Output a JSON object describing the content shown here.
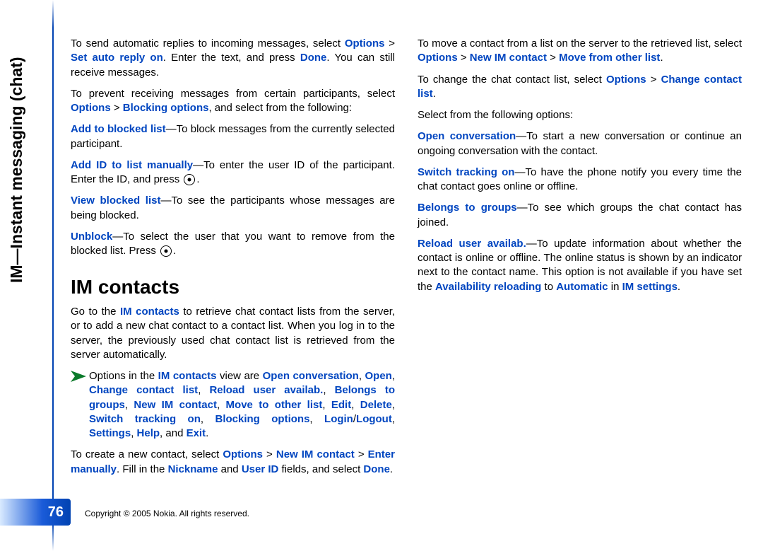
{
  "side_title": "IM—Instant messaging (chat)",
  "page_number": "76",
  "footer": "Copyright © 2005 Nokia. All rights reserved.",
  "heading": "IM contacts",
  "left": {
    "auto_reply_1": "To send automatic replies to incoming messages, select ",
    "auto_reply_2": "Options",
    "auto_reply_3": " > ",
    "auto_reply_4": "Set auto reply on",
    "auto_reply_5": ". Enter the text, and press ",
    "auto_reply_6": "Done",
    "auto_reply_7": ". You can still receive messages.",
    "block_prev_1": "To prevent receiving messages from certain participants, select ",
    "block_prev_2": "Options",
    "block_prev_3": " > ",
    "block_prev_4": "Blocking options",
    "block_prev_5": ", and select from the following:",
    "add_block_1": "Add to blocked list",
    "add_block_2": "—To block messages from the currently selected participant.",
    "add_id_1": "Add ID to list manually",
    "add_id_2": "—To enter the user ID of the participant. Enter the ID, and press ",
    "add_id_3": ".",
    "view_block_1": "View blocked list",
    "view_block_2": "—To see the participants whose messages are being blocked.",
    "unblock_1": "Unblock",
    "unblock_2": "—To select the user that you want to remove from the blocked list. Press ",
    "unblock_3": ".",
    "goto_1": "Go to the ",
    "goto_2": "IM contacts",
    "goto_3": " to retrieve chat contact lists from the server, or to add a new chat contact to a contact list. When you log in to the server, the previously used chat contact list is retrieved from the server automatically.",
    "optlist_1": "Options in the ",
    "optlist_2": "IM contacts",
    "optlist_3": " view are ",
    "optlist_4": "Open conversation",
    "optlist_5": ", ",
    "optlist_6": "Open",
    "optlist_7": ", ",
    "optlist_8": "Change contact list",
    "optlist_9": ", ",
    "optlist_10": "Reload user availab.",
    "optlist_11": ", ",
    "optlist_12": "Belongs to groups",
    "optlist_13": ", ",
    "optlist_14": "New IM contact",
    "optlist_15": ", ",
    "optlist_16": "Move to"
  },
  "right": {
    "optlist2_1": "other list",
    "optlist2_2": ", ",
    "optlist2_3": "Edit",
    "optlist2_4": ", ",
    "optlist2_5": "Delete",
    "optlist2_6": ", ",
    "optlist2_7": "Switch tracking on",
    "optlist2_8": ", ",
    "optlist2_9": "Blocking options",
    "optlist2_10": ", ",
    "optlist2_11": "Login",
    "optlist2_12": "/",
    "optlist2_13": "Logout",
    "optlist2_14": ", ",
    "optlist2_15": "Settings",
    "optlist2_16": ", ",
    "optlist2_17": "Help",
    "optlist2_18": ", and ",
    "optlist2_19": "Exit",
    "optlist2_20": ".",
    "new_1": "To create a new contact, select ",
    "new_2": "Options",
    "new_3": " > ",
    "new_4": "New IM contact",
    "new_5": " > ",
    "new_6": "Enter manually",
    "new_7": ". Fill in the ",
    "new_8": "Nickname",
    "new_9": " and ",
    "new_10": "User ID",
    "new_11": " fields, and select ",
    "new_12": "Done",
    "new_13": ".",
    "move_1": "To move a contact from a list on the server to the retrieved list, select ",
    "move_2": "Options",
    "move_3": " > ",
    "move_4": "New IM contact",
    "move_5": " > ",
    "move_6": "Move from other list",
    "move_7": ".",
    "change_1": "To change the chat contact list, select ",
    "change_2": "Options",
    "change_3": " > ",
    "change_4": "Change contact list",
    "change_5": ".",
    "select_1": "Select from the following options:",
    "opconv_1": "Open conversation",
    "opconv_2": "—To start a new conversation or continue an ongoing conversation with the contact.",
    "swtrack_1": "Switch tracking on",
    "swtrack_2": "—To have the phone notify you every time the chat contact goes online or offline.",
    "belong_1": "Belongs to groups",
    "belong_2": "—To see which groups the chat contact has joined.",
    "reload_1": "Reload user availab.",
    "reload_2": "—To update information about whether the contact is online or offline. The online status is shown by an indicator next to the contact name. This option is not available if you have set the ",
    "reload_3": "Availability reloading",
    "reload_4": " to ",
    "reload_5": "Automatic",
    "reload_6": " in ",
    "reload_7": "IM settings",
    "reload_8": "."
  }
}
